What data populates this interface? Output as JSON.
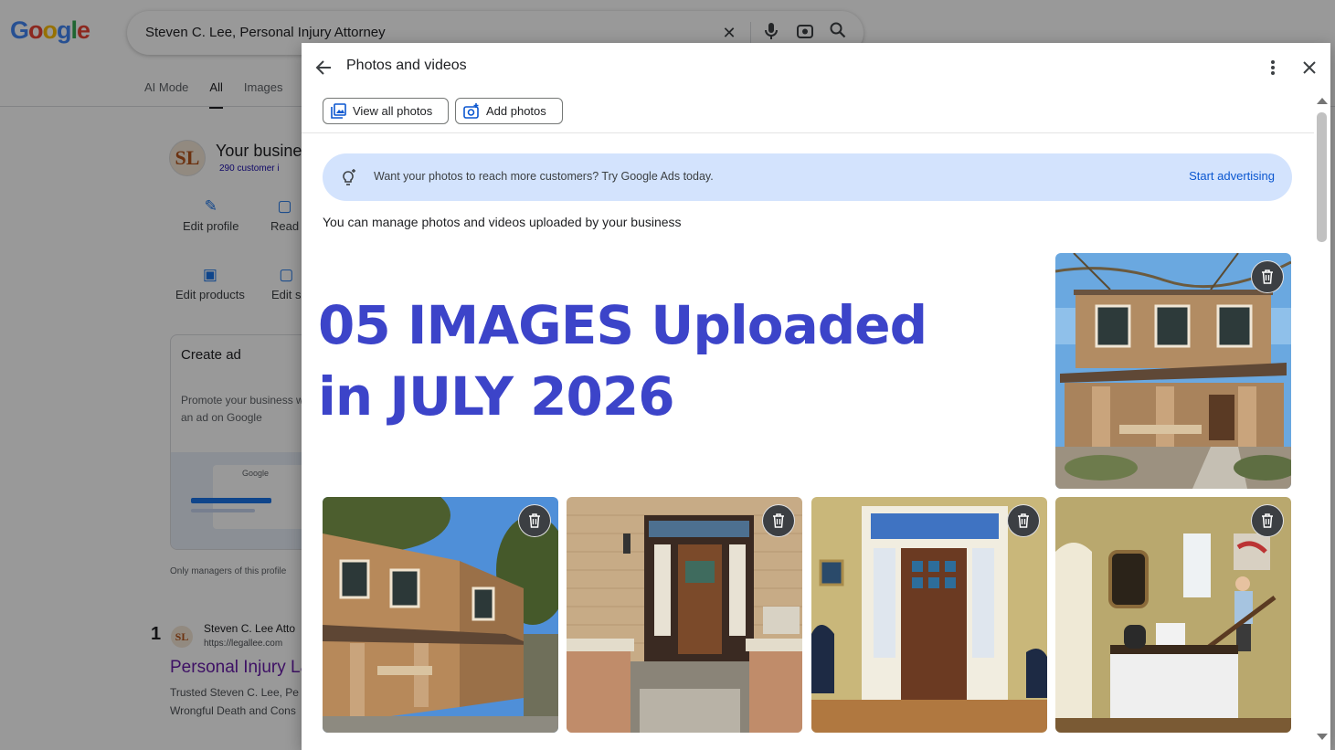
{
  "search": {
    "query": "Steven C. Lee, Personal Injury Attorney"
  },
  "logo": [
    "G",
    "o",
    "o",
    "g",
    "l",
    "e"
  ],
  "tabs": [
    "AI Mode",
    "All",
    "Images"
  ],
  "business": {
    "initials": "SL",
    "title": "Your busine",
    "sub": "290 customer i",
    "actions": [
      "Edit profile",
      "Read",
      "Edit products",
      "Edit s"
    ],
    "create_ad_title": "Create ad",
    "create_ad_desc": "Promote your business with an ad on Google",
    "create_ad_google": "Google",
    "only_managers": "Only managers of this profile"
  },
  "result": {
    "rank": "1",
    "initials": "SL",
    "site": "Steven C. Lee Atto",
    "url": "https://legallee.com",
    "title": "Personal Injury La",
    "snippet": "Trusted Steven C. Lee, Pe Wrongful Death and Cons"
  },
  "dialog": {
    "title": "Photos and videos",
    "view_all": "View all photos",
    "add_photos": "Add photos",
    "banner_text": "Want your photos to reach more customers? Try Google Ads today.",
    "banner_cta": "Start advertising",
    "manage_text": "You can manage photos and videos uploaded by your business",
    "headline_line1": "05 IMAGES Uploaded",
    "headline_line2": "in JULY 2026"
  },
  "photos": [
    {
      "subject": "front of brick two-story house with porch"
    },
    {
      "subject": "side view of brick house under blue sky"
    },
    {
      "subject": "wooden front door with brick entry"
    },
    {
      "subject": "interior view of front door from lobby"
    },
    {
      "subject": "reception desk with man on staircase"
    }
  ],
  "colors": {
    "headline": "#3c44c9",
    "accent": "#0b57d0",
    "banner": "#d3e3fd"
  }
}
